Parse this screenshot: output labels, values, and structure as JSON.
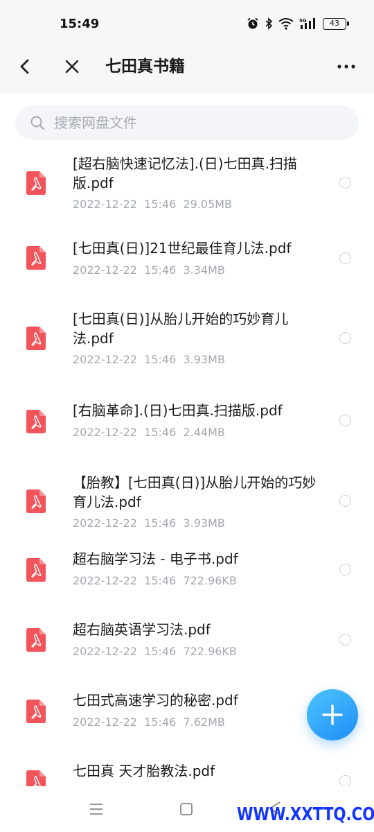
{
  "status_bar": {
    "time": "15:49",
    "battery": "43",
    "icons": [
      "alarm-icon",
      "bluetooth-icon",
      "wifi-icon",
      "signal-5g-icon",
      "battery-icon"
    ]
  },
  "header": {
    "title": "七田真书籍",
    "back_icon": "chevron-left-icon",
    "close_icon": "close-icon",
    "more_icon": "more-dots-icon"
  },
  "search": {
    "placeholder": "搜索网盘文件",
    "value": ""
  },
  "files": [
    {
      "name": "[超右脑快速记忆法].(日)七田真.扫描版.pdf",
      "date": "2022-12-22",
      "time": "15:46",
      "size": "29.05MB"
    },
    {
      "name": "[七田真(日)]21世纪最佳育儿法.pdf",
      "date": "2022-12-22",
      "time": "15:46",
      "size": "3.34MB"
    },
    {
      "name": "[七田真(日)]从胎儿开始的巧妙育儿法.pdf",
      "date": "2022-12-22",
      "time": "15:46",
      "size": "3.93MB"
    },
    {
      "name": "[右脑革命].(日)七田真.扫描版.pdf",
      "date": "2022-12-22",
      "time": "15:46",
      "size": "2.44MB"
    },
    {
      "name": "【胎教】[七田真(日)]从胎儿开始的巧妙育儿法.pdf",
      "date": "2022-12-22",
      "time": "15:46",
      "size": "3.93MB"
    },
    {
      "name": "超右脑学习法 - 电子书.pdf",
      "date": "2022-12-22",
      "time": "15:46",
      "size": "722.96KB"
    },
    {
      "name": "超右脑英语学习法.pdf",
      "date": "2022-12-22",
      "time": "15:46",
      "size": "722.96KB"
    },
    {
      "name": "七田式高速学习的秘密.pdf",
      "date": "2022-12-22",
      "time": "15:46",
      "size": "7.62MB"
    },
    {
      "name": "七田真 天才胎教法.pdf",
      "date": "",
      "time": "",
      "size": ""
    }
  ],
  "fab": {
    "icon": "plus-icon"
  },
  "colors": {
    "accent": "#2196f3",
    "pdf_icon": "#f2545b",
    "watermark": "#1335ff"
  },
  "watermark": "WWW.XXTTQ.COM"
}
